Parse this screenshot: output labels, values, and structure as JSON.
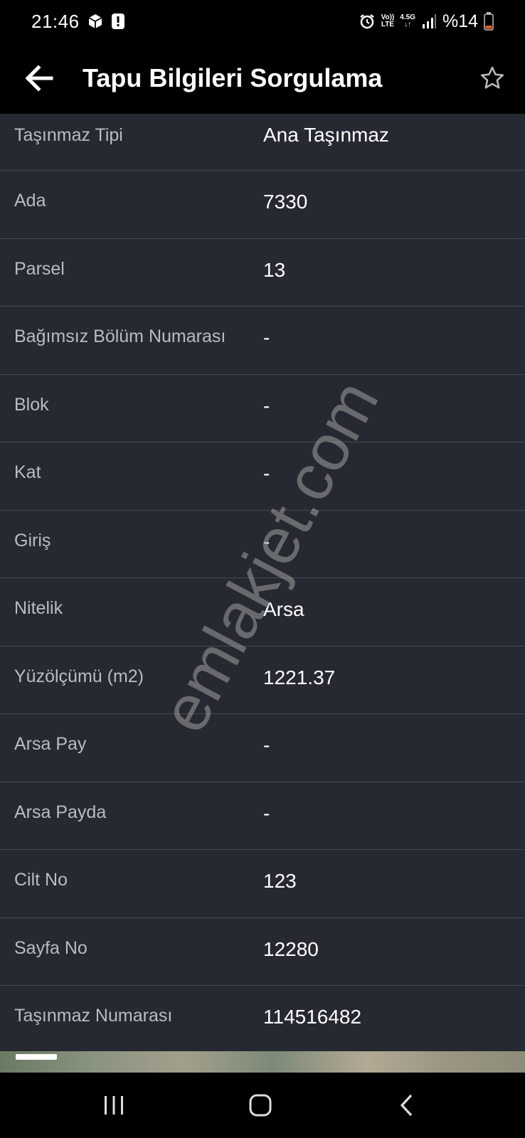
{
  "status_bar": {
    "time": "21:46",
    "network_label_top": "Vo))",
    "network_label_bottom": "LTE",
    "signal_label": "4.5G",
    "battery_text": "%14",
    "battery_color": "#e05a2b"
  },
  "app_bar": {
    "title": "Tapu Bilgileri Sorgulama",
    "back_icon": "arrow-left-icon",
    "star_icon": "star-outline-icon"
  },
  "rows": [
    {
      "label": "Taşınmaz Tipi",
      "value": "Ana Taşınmaz"
    },
    {
      "label": "Ada",
      "value": "7330"
    },
    {
      "label": "Parsel",
      "value": "13"
    },
    {
      "label": "Bağımsız Bölüm Numarası",
      "value": "-"
    },
    {
      "label": "Blok",
      "value": "-"
    },
    {
      "label": "Kat",
      "value": "-"
    },
    {
      "label": "Giriş",
      "value": "-"
    },
    {
      "label": "Nitelik",
      "value": "Arsa"
    },
    {
      "label": "Yüzölçümü (m2)",
      "value": "1221.37"
    },
    {
      "label": "Arsa Pay",
      "value": "-"
    },
    {
      "label": "Arsa Payda",
      "value": "-"
    },
    {
      "label": "Cilt No",
      "value": "123"
    },
    {
      "label": "Sayfa No",
      "value": "12280"
    },
    {
      "label": "Taşınmaz Numarası",
      "value": "114516482"
    }
  ],
  "watermark": "emlakjet.com",
  "colors": {
    "list_background": "#262932",
    "divider": "#474a52",
    "label_text": "#b9bcc2",
    "value_text": "#ffffff"
  },
  "nav_bar": {
    "recents_icon": "recents-icon",
    "home_icon": "home-icon",
    "back_icon": "back-chevron-icon"
  }
}
